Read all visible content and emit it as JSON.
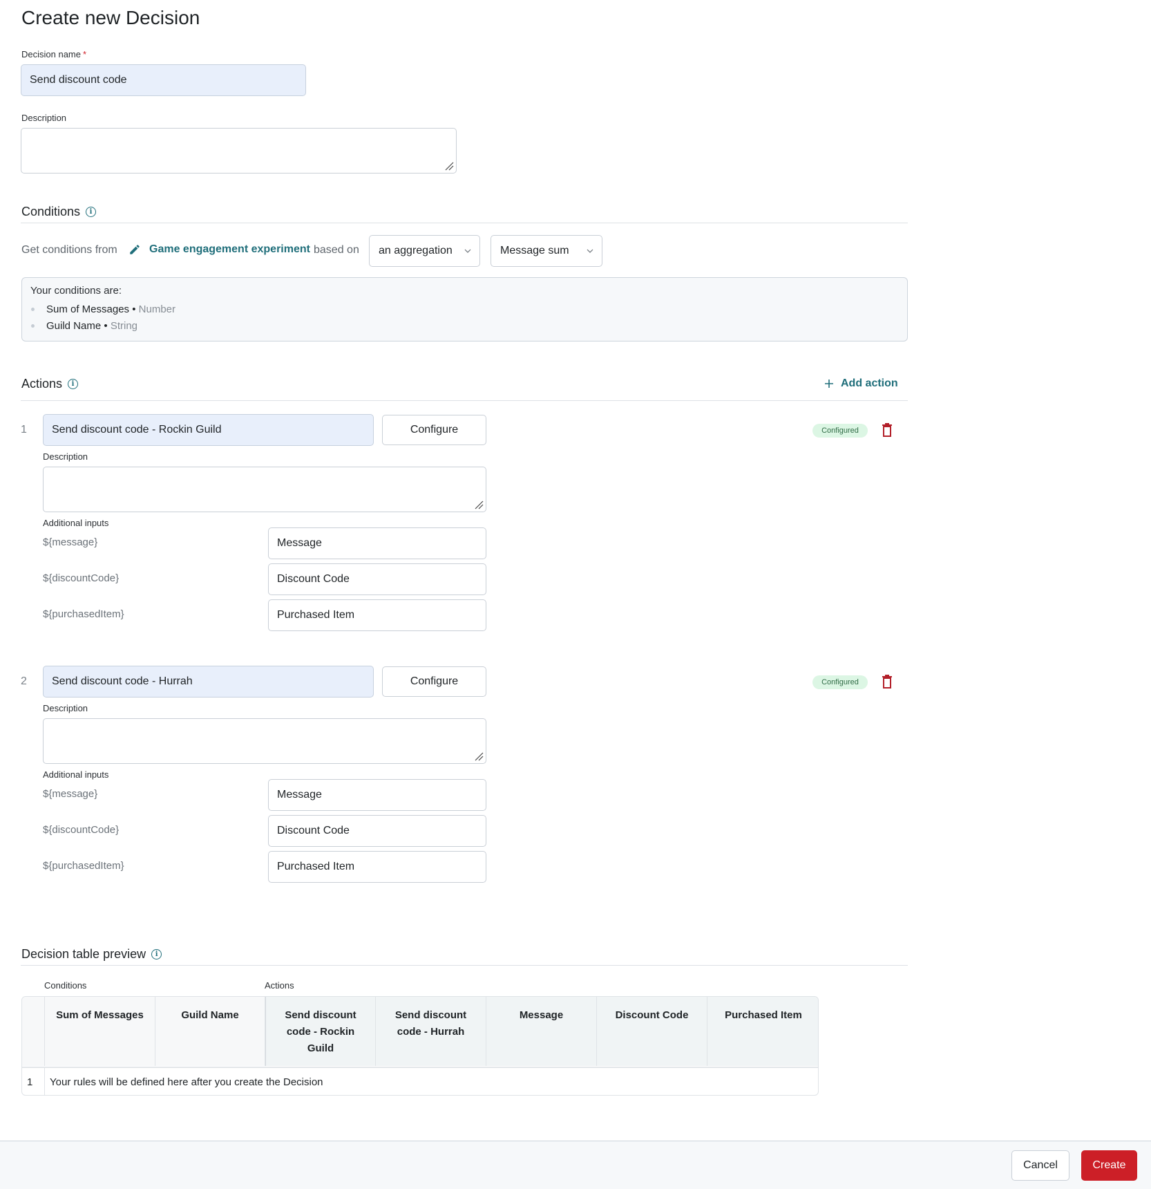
{
  "page": {
    "title": "Create new Decision"
  },
  "decision_name": {
    "label": "Decision name",
    "required_mark": "*",
    "value": "Send discount code"
  },
  "description": {
    "label": "Description",
    "value": ""
  },
  "conditions": {
    "title": "Conditions",
    "source_prefix": "Get conditions from",
    "source_link": "Game engagement experiment",
    "based_on": "based on",
    "basis_select": "an aggregation",
    "aggregation_select": "Message sum",
    "box_heading": "Your conditions are:",
    "items": [
      {
        "name": "Sum of Messages",
        "separator": "•",
        "type": "Number"
      },
      {
        "name": "Guild Name",
        "separator": "•",
        "type": "String"
      }
    ]
  },
  "actions": {
    "title": "Actions",
    "add_label": "Add action",
    "configure_label": "Configure",
    "description_label": "Description",
    "additional_inputs_label": "Additional inputs",
    "status_label": "Configured",
    "items": [
      {
        "index": "1",
        "name": "Send discount code - Rockin Guild",
        "description": "",
        "inputs": [
          {
            "variable": "${message}",
            "value": "Message"
          },
          {
            "variable": "${discountCode}",
            "value": "Discount Code"
          },
          {
            "variable": "${purchasedItem}",
            "value": "Purchased Item"
          }
        ]
      },
      {
        "index": "2",
        "name": "Send discount code - Hurrah",
        "description": "",
        "inputs": [
          {
            "variable": "${message}",
            "value": "Message"
          },
          {
            "variable": "${discountCode}",
            "value": "Discount Code"
          },
          {
            "variable": "${purchasedItem}",
            "value": "Purchased Item"
          }
        ]
      }
    ]
  },
  "preview": {
    "title": "Decision table preview",
    "conditions_group": "Conditions",
    "actions_group": "Actions",
    "columns": [
      "Sum of Messages",
      "Guild Name",
      "Send discount code - Rockin Guild",
      "Send discount code - Hurrah",
      "Message",
      "Discount Code",
      "Purchased Item"
    ],
    "rows": [
      {
        "index": "1",
        "text": "Your rules will be defined here after you create the Decision"
      }
    ]
  },
  "footer": {
    "cancel_label": "Cancel",
    "create_label": "Create"
  },
  "colors": {
    "accent": "#1f6e7a",
    "primary": "#cc1f27",
    "danger": "#b3202a",
    "success_bg": "#dcf6e4"
  }
}
